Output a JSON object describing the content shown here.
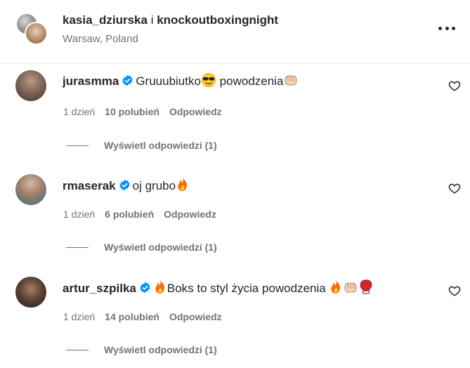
{
  "header": {
    "user1": "kasia_dziurska",
    "connector": "i",
    "user2": "knockoutboxingnight",
    "location": "Warsaw, Poland"
  },
  "comments": [
    {
      "username": "jurasmma",
      "text_before": "Gruuubiutko",
      "text_middle": " powodzenia",
      "emojis": [
        "smiling-face-with-sunglasses",
        "oncoming-fist"
      ],
      "time": "1 dzień",
      "likes": "10 polubień",
      "reply": "Odpowiedz",
      "view_replies": "Wyświetl odpowiedzi (1)"
    },
    {
      "username": "rmaserak",
      "text_before": "oj grubo",
      "emojis": [
        "fire"
      ],
      "time": "1 dzień",
      "likes": "6 polubień",
      "reply": "Odpowiedz",
      "view_replies": "Wyświetl odpowiedzi (1)"
    },
    {
      "username": "artur_szpilka",
      "text_before": "Boks to styl życia powodzenia ",
      "emojis": [
        "fire",
        "fire",
        "oncoming-fist",
        "boxing-glove"
      ],
      "time": "1 dzień",
      "likes": "14 polubień",
      "reply": "Odpowiedz",
      "view_replies": "Wyświetl odpowiedzi (1)"
    }
  ],
  "colors": {
    "text": "#262626",
    "secondary": "#737373",
    "verified": "#0095f6",
    "divider": "#efefef"
  }
}
